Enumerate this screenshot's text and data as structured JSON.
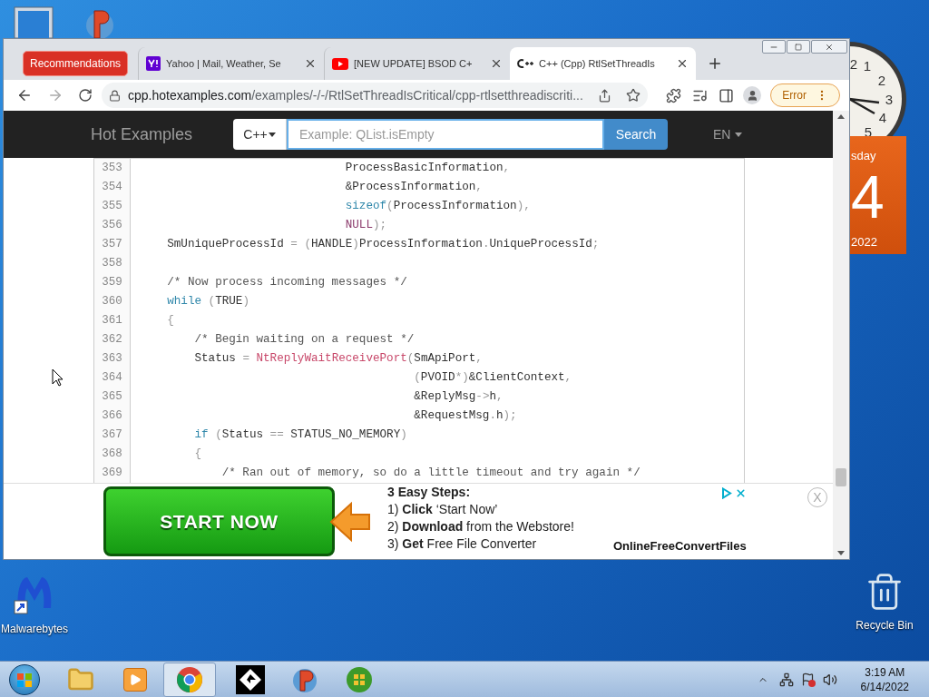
{
  "desktop": {
    "icons": [
      {
        "label": "Malwarebytes",
        "kind": "malwarebytes"
      },
      {
        "label": "Recycle Bin",
        "kind": "recycle"
      }
    ]
  },
  "clock_gadget": {
    "numerals": [
      "2",
      "1",
      "2",
      "3",
      "4",
      "5"
    ]
  },
  "calendar_gadget": {
    "weekday": "sday",
    "day": "4",
    "year": "2022"
  },
  "browser": {
    "tab_group": {
      "label": "Recommendations"
    },
    "tabs": [
      {
        "title": "Yahoo | Mail, Weather, Se",
        "kind": "yahoo",
        "selected": false
      },
      {
        "title": "[NEW UPDATE] BSOD C+",
        "kind": "video",
        "selected": false
      },
      {
        "title": "C++ (Cpp) RtlSetThreadIs",
        "kind": "code",
        "selected": true
      }
    ],
    "address_bar": {
      "host": "cpp.hotexamples.com",
      "path": "/examples/-/-/RtlSetThreadIsCritical/cpp-rtlsetthreadiscriti..."
    },
    "profile_button": {
      "label": "Error"
    }
  },
  "site": {
    "brand": "Hot Examples",
    "language": "C++",
    "search_placeholder": "Example: QList.isEmpty",
    "search_button": "Search",
    "locale": "EN"
  },
  "code": {
    "lines": [
      {
        "number": "353",
        "tokens": [
          {
            "kind": "plain",
            "text": "                              ProcessBasicInformation"
          },
          {
            "kind": "punct",
            "text": ","
          }
        ]
      },
      {
        "number": "354",
        "tokens": [
          {
            "kind": "plain",
            "text": "                              &ProcessInformation"
          },
          {
            "kind": "punct",
            "text": ","
          }
        ]
      },
      {
        "number": "355",
        "tokens": [
          {
            "kind": "keyword",
            "text": "                              sizeof"
          },
          {
            "kind": "punct",
            "text": "("
          },
          {
            "kind": "plain",
            "text": "ProcessInformation"
          },
          {
            "kind": "punct",
            "text": "),"
          }
        ]
      },
      {
        "number": "356",
        "tokens": [
          {
            "kind": "const",
            "text": "                              NULL"
          },
          {
            "kind": "punct",
            "text": ");"
          }
        ]
      },
      {
        "number": "357",
        "tokens": [
          {
            "kind": "plain",
            "text": "    SmUniqueProcessId "
          },
          {
            "kind": "punct",
            "text": "= ("
          },
          {
            "kind": "plain",
            "text": "HANDLE"
          },
          {
            "kind": "punct",
            "text": ")"
          },
          {
            "kind": "plain",
            "text": "ProcessInformation"
          },
          {
            "kind": "punct",
            "text": "."
          },
          {
            "kind": "plain",
            "text": "UniqueProcessId"
          },
          {
            "kind": "punct",
            "text": ";"
          }
        ]
      },
      {
        "number": "358"
      },
      {
        "number": "359",
        "tokens": [
          {
            "kind": "comment",
            "text": "    /* Now process incoming messages */"
          }
        ]
      },
      {
        "number": "360",
        "tokens": [
          {
            "kind": "keyword",
            "text": "    while"
          },
          {
            "kind": "punct",
            "text": " ("
          },
          {
            "kind": "plain",
            "text": "TRUE"
          },
          {
            "kind": "punct",
            "text": ")"
          }
        ]
      },
      {
        "number": "361",
        "tokens": [
          {
            "kind": "punct",
            "text": "    {"
          }
        ]
      },
      {
        "number": "362",
        "tokens": [
          {
            "kind": "comment",
            "text": "        /* Begin waiting on a request */"
          }
        ]
      },
      {
        "number": "363",
        "tokens": [
          {
            "kind": "plain",
            "text": "        Status "
          },
          {
            "kind": "punct",
            "text": "= "
          },
          {
            "kind": "func",
            "text": "NtReplyWaitReceivePort"
          },
          {
            "kind": "punct",
            "text": "("
          },
          {
            "kind": "plain",
            "text": "SmApiPort"
          },
          {
            "kind": "punct",
            "text": ","
          }
        ]
      },
      {
        "number": "364",
        "tokens": [
          {
            "kind": "punct",
            "text": "                                        ("
          },
          {
            "kind": "plain",
            "text": "PVOID"
          },
          {
            "kind": "punct",
            "text": "*)"
          },
          {
            "kind": "plain",
            "text": "&ClientContext"
          },
          {
            "kind": "punct",
            "text": ","
          }
        ]
      },
      {
        "number": "365",
        "tokens": [
          {
            "kind": "plain",
            "text": "                                        &ReplyMsg"
          },
          {
            "kind": "punct",
            "text": "->"
          },
          {
            "kind": "plain",
            "text": "h"
          },
          {
            "kind": "punct",
            "text": ","
          }
        ]
      },
      {
        "number": "366",
        "tokens": [
          {
            "kind": "plain",
            "text": "                                        &RequestMsg"
          },
          {
            "kind": "punct",
            "text": "."
          },
          {
            "kind": "plain",
            "text": "h"
          },
          {
            "kind": "punct",
            "text": ");"
          }
        ]
      },
      {
        "number": "367",
        "tokens": [
          {
            "kind": "keyword",
            "text": "        if"
          },
          {
            "kind": "punct",
            "text": " ("
          },
          {
            "kind": "plain",
            "text": "Status "
          },
          {
            "kind": "punct",
            "text": "== "
          },
          {
            "kind": "plain",
            "text": "STATUS_NO_MEMORY"
          },
          {
            "kind": "punct",
            "text": ")"
          }
        ]
      },
      {
        "number": "368",
        "tokens": [
          {
            "kind": "punct",
            "text": "        {"
          }
        ]
      },
      {
        "number": "369",
        "tokens": [
          {
            "kind": "comment",
            "text": "            /* Ran out of memory, so do a little timeout and try again */"
          }
        ]
      }
    ]
  },
  "ad": {
    "button": "START NOW",
    "heading": "3 Easy Steps:",
    "steps": [
      "1) **Click** ‘Start Now’",
      "2) **Download** from the Webstore!",
      "3) **Get** Free File Converter"
    ],
    "advertiser": "OnlineFreeConvertFiles",
    "close": "X"
  },
  "taskbar": {
    "apps": [
      {
        "kind": "folder",
        "selected": false
      },
      {
        "kind": "media",
        "selected": false
      },
      {
        "kind": "chrome",
        "selected": true
      },
      {
        "kind": "gicon",
        "selected": false
      },
      {
        "kind": "picon",
        "selected": false
      },
      {
        "kind": "orb",
        "selected": false
      }
    ],
    "time": "3:19 AM",
    "date": "6/14/2022"
  }
}
